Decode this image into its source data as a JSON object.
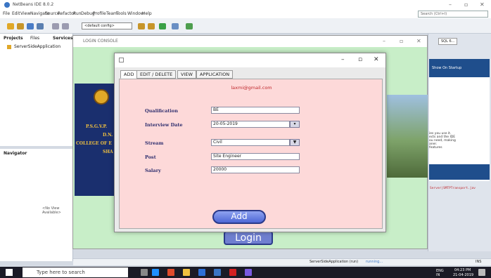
{
  "ide": {
    "title": "NetBeans IDE 8.0.2",
    "menu": [
      "File",
      "Edit",
      "View",
      "Navigate",
      "Source",
      "Refactor",
      "Run",
      "Debug",
      "Profile",
      "Team",
      "Tools",
      "Window",
      "Help"
    ],
    "search_placeholder": "Search (Ctrl+I)",
    "config": "<default config>",
    "projects_tab": "Projects",
    "files_tab": "Files",
    "services_tab": "Services",
    "project_item": "ServerSideApplication",
    "navigator_tab": "Navigator",
    "navigator_empty": "<No View Available>",
    "right_tab": "SQL 6...",
    "start_label": "Show On Startup",
    "right_text": [
      "ies you use it.",
      "ects and the IDE",
      "ou need, making",
      "aner.",
      "features"
    ],
    "output_line": "Server|SMTPTransport.jav",
    "status_project": "ServerSideApplication (run)",
    "status_running": "running...",
    "status_right": "INS"
  },
  "login_window": {
    "title": "LOGIN CONSOLE",
    "banner_lines": [
      "P.S.G.V.P.",
      "D.N.",
      "COLLEGE OF E",
      "SHA"
    ],
    "login_button": "Login"
  },
  "dialog": {
    "tabs": [
      "ADD",
      "EDIT / DELETE",
      "VIEW",
      "APPLICATION"
    ],
    "active_tab": "ADD",
    "email": "laxmi@gmail.com",
    "fields": {
      "qualification": {
        "label": "Qualification",
        "value": "BE"
      },
      "interview_date": {
        "label": "Interview Date",
        "value": "20-05-2019"
      },
      "stream": {
        "label": "Stream",
        "value": "Civil"
      },
      "post": {
        "label": "Post",
        "value": "Site Engineer"
      },
      "salary": {
        "label": "Salary",
        "value": "20000"
      }
    },
    "add_button": "Add"
  },
  "taskbar": {
    "search_placeholder": "Type here to search",
    "language": "ENG",
    "time": "04:23 PM",
    "region": "IN",
    "date": "21-04-2019"
  }
}
